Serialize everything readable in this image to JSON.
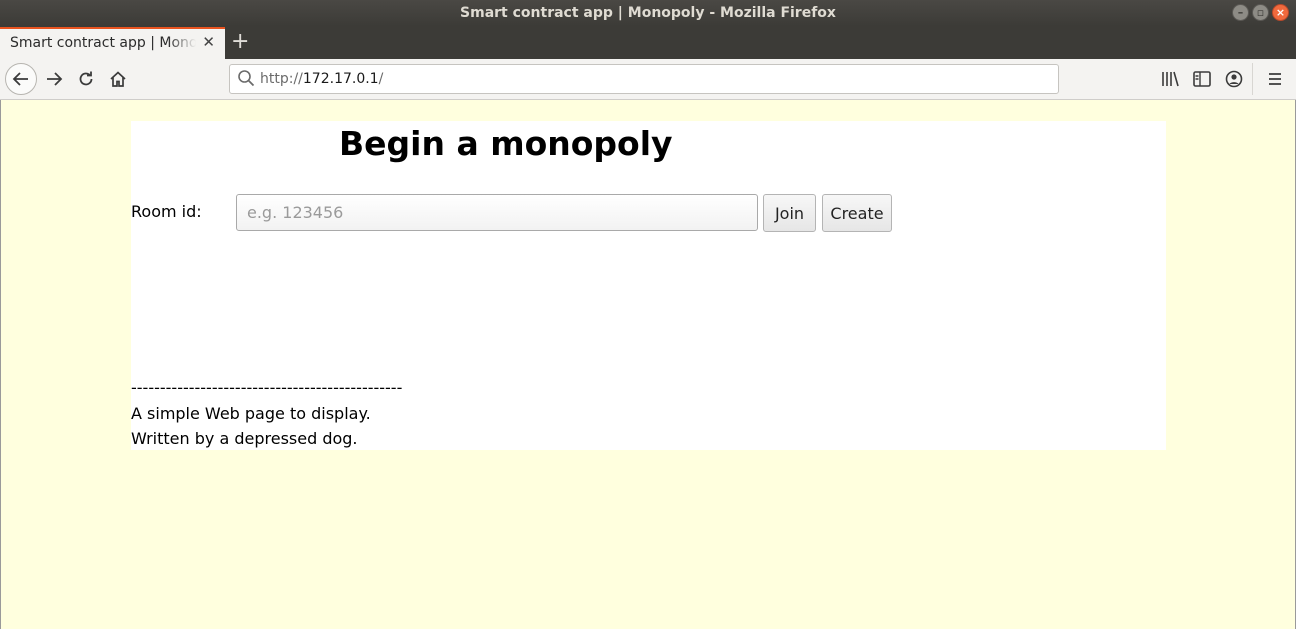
{
  "window": {
    "title": "Smart contract app | Monopoly - Mozilla Firefox"
  },
  "tab": {
    "title": "Smart contract app | Monopoly",
    "close_icon": "close-icon"
  },
  "address_bar": {
    "scheme": "http://",
    "host": "172.17.0.1",
    "path": "/"
  },
  "page": {
    "heading": "Begin a monopoly",
    "room_label": "Room id:",
    "room_placeholder": "e.g. 123456",
    "room_value": "",
    "join_label": "Join",
    "create_label": "Create",
    "footer": {
      "divider": "-----------------------------------------------",
      "line1": "A simple Web page to display.",
      "line2": "Written by a depressed dog."
    }
  },
  "colors": {
    "page_background": "#ffffde",
    "accent": "#e95420"
  }
}
